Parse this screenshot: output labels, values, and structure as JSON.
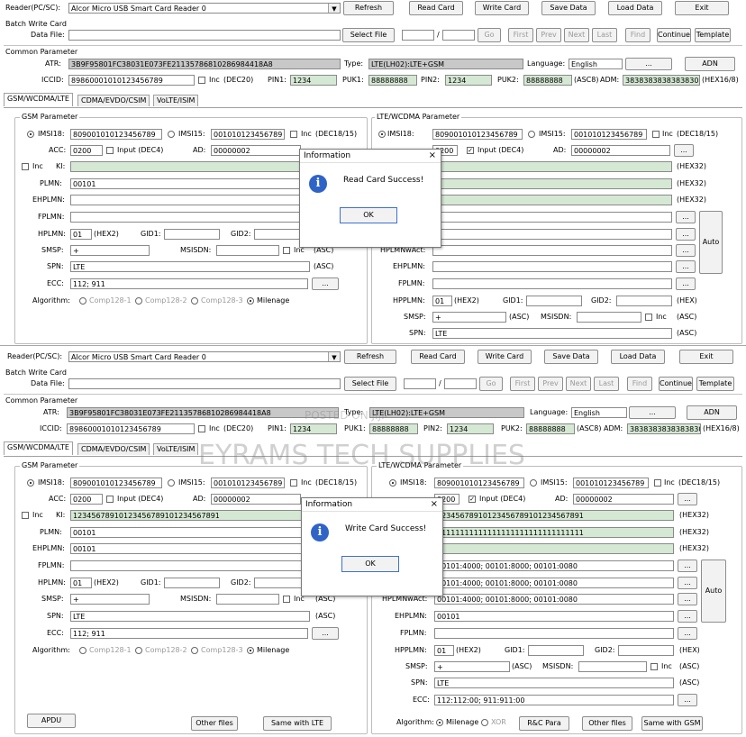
{
  "labels": {
    "reader": "Reader(PC/SC):",
    "reader_device": "Alcor Micro USB Smart Card Reader 0",
    "refresh": "Refresh",
    "read_card": "Read Card",
    "write_card": "Write Card",
    "save_data": "Save Data",
    "load_data": "Load Data",
    "exit": "Exit",
    "batch_write_card": "Batch Write Card",
    "data_file": "Data File:",
    "select_file": "Select File",
    "slash": "/",
    "go": "Go",
    "first": "First",
    "prev": "Prev",
    "next": "Next",
    "last": "Last",
    "find": "Find",
    "continue": "Continue",
    "template": "Template",
    "common_parameter": "Common Parameter",
    "atr": "ATR:",
    "atr_value": "3B9F95801FC38031E073FE21135786810286984418A8",
    "type": "Type:",
    "type_value": "LTE(LH02):LTE+GSM",
    "language": "Language:",
    "language_value": "English",
    "adn": "ADN",
    "iccid": "ICCID:",
    "iccid_value": "89860001010123456789",
    "inc": "Inc",
    "dec20": "(DEC20)",
    "pin1": "PIN1:",
    "pin1_value": "1234",
    "puk1": "PUK1:",
    "puk1_value": "88888888",
    "pin2": "PIN2:",
    "pin2_value": "1234",
    "puk2": "PUK2:",
    "puk2_value": "88888888",
    "asc8": "(ASC8)",
    "adm": "ADM:",
    "adm_value": "3838383838383830",
    "hex168": "(HEX16/8)",
    "tab_gsm": "GSM/WCDMA/LTE",
    "tab_cdma": "CDMA/EVDO/CSIM",
    "tab_volte": "VoLTE/ISIM",
    "gsm_parameter": "GSM Parameter",
    "lte_parameter": "LTE/WCDMA Parameter",
    "imsi18": "IMSI18:",
    "imsi18_value": "809001010123456789",
    "imsi15": "IMSI15:",
    "imsi15_value": "001010123456789",
    "dec1815": "(DEC18/15)",
    "acc": "ACC:",
    "acc_value": "0200",
    "input_dec4": "Input (DEC4)",
    "ad": "AD:",
    "ad_value": "00000002",
    "ki": "KI:",
    "hex32": "(HEX32)",
    "plmn": "PLMN:",
    "plmn_value": "00101",
    "ehplmn": "EHPLMN:",
    "fplmn": "FPLMN:",
    "hplmn": "HPLMN:",
    "hplmn_value": "01",
    "hex2": "(HEX2)",
    "gid1": "GID1:",
    "gid2": "GID2:",
    "smsp": "SMSP:",
    "smsp_value": "+",
    "msisdn": "MSISDN:",
    "asc": "(ASC)",
    "spn": "SPN:",
    "spn_value": "LTE",
    "ecc": "ECC:",
    "ecc_value": "112; 911",
    "algorithm": "Algorithm:",
    "comp128_1": "Comp128-1",
    "comp128_2": "Comp128-2",
    "comp128_3": "Comp128-3",
    "milenage": "Milenage",
    "xor": "XOR",
    "ellipsis": "...",
    "auto": "Auto",
    "hplmnwact": "HPLMNwAct:",
    "hpplmn": "HPPLMN:",
    "hex": "(HEX)",
    "apdu": "APDU",
    "other_files": "Other files",
    "same_with_lte": "Same with LTE",
    "rc_para": "R&C Para",
    "same_with_gsm": "Same with GSM",
    "watermark_posted": "POSTED ON JIJI",
    "watermark_brand": "EYRAMS TECH SUPPLIES"
  },
  "screen2": {
    "ki_value": "12345678910123456789101234567891",
    "ehplmn_value": "00101",
    "lte_ki_value": "12345678910123456789101234567891",
    "lte_opc_value": "11111111111111111111111111111111",
    "lte_fplmn_value": "00101:4000; 00101:8000; 00101:0080",
    "lte_hplmn_value": "00101:4000; 00101:8000; 00101:0080",
    "lte_hplmnwact_value": "00101:4000; 00101:8000; 00101:0080",
    "lte_ehplmn_value": "00101",
    "lte_ecc_value": "112:112:00; 911:911:00"
  },
  "dialogs": {
    "title": "Information",
    "close": "×",
    "read_success": "Read Card Success!",
    "write_success": "Write Card Success!",
    "ok": "OK"
  }
}
